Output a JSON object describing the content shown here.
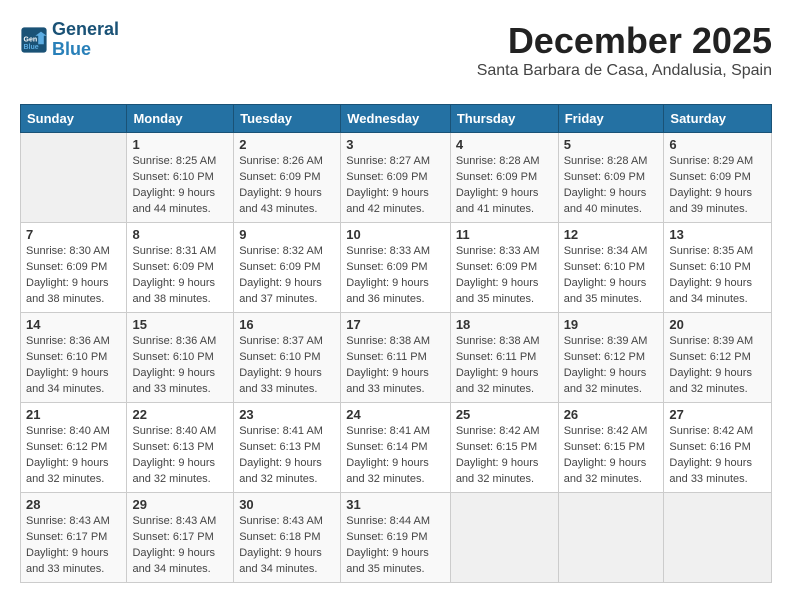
{
  "logo": {
    "line1": "General",
    "line2": "Blue"
  },
  "title": "December 2025",
  "location": "Santa Barbara de Casa, Andalusia, Spain",
  "days_of_week": [
    "Sunday",
    "Monday",
    "Tuesday",
    "Wednesday",
    "Thursday",
    "Friday",
    "Saturday"
  ],
  "weeks": [
    [
      {
        "day": "",
        "sunrise": "",
        "sunset": "",
        "daylight": ""
      },
      {
        "day": "1",
        "sunrise": "Sunrise: 8:25 AM",
        "sunset": "Sunset: 6:10 PM",
        "daylight": "Daylight: 9 hours and 44 minutes."
      },
      {
        "day": "2",
        "sunrise": "Sunrise: 8:26 AM",
        "sunset": "Sunset: 6:09 PM",
        "daylight": "Daylight: 9 hours and 43 minutes."
      },
      {
        "day": "3",
        "sunrise": "Sunrise: 8:27 AM",
        "sunset": "Sunset: 6:09 PM",
        "daylight": "Daylight: 9 hours and 42 minutes."
      },
      {
        "day": "4",
        "sunrise": "Sunrise: 8:28 AM",
        "sunset": "Sunset: 6:09 PM",
        "daylight": "Daylight: 9 hours and 41 minutes."
      },
      {
        "day": "5",
        "sunrise": "Sunrise: 8:28 AM",
        "sunset": "Sunset: 6:09 PM",
        "daylight": "Daylight: 9 hours and 40 minutes."
      },
      {
        "day": "6",
        "sunrise": "Sunrise: 8:29 AM",
        "sunset": "Sunset: 6:09 PM",
        "daylight": "Daylight: 9 hours and 39 minutes."
      }
    ],
    [
      {
        "day": "7",
        "sunrise": "Sunrise: 8:30 AM",
        "sunset": "Sunset: 6:09 PM",
        "daylight": "Daylight: 9 hours and 38 minutes."
      },
      {
        "day": "8",
        "sunrise": "Sunrise: 8:31 AM",
        "sunset": "Sunset: 6:09 PM",
        "daylight": "Daylight: 9 hours and 38 minutes."
      },
      {
        "day": "9",
        "sunrise": "Sunrise: 8:32 AM",
        "sunset": "Sunset: 6:09 PM",
        "daylight": "Daylight: 9 hours and 37 minutes."
      },
      {
        "day": "10",
        "sunrise": "Sunrise: 8:33 AM",
        "sunset": "Sunset: 6:09 PM",
        "daylight": "Daylight: 9 hours and 36 minutes."
      },
      {
        "day": "11",
        "sunrise": "Sunrise: 8:33 AM",
        "sunset": "Sunset: 6:09 PM",
        "daylight": "Daylight: 9 hours and 35 minutes."
      },
      {
        "day": "12",
        "sunrise": "Sunrise: 8:34 AM",
        "sunset": "Sunset: 6:10 PM",
        "daylight": "Daylight: 9 hours and 35 minutes."
      },
      {
        "day": "13",
        "sunrise": "Sunrise: 8:35 AM",
        "sunset": "Sunset: 6:10 PM",
        "daylight": "Daylight: 9 hours and 34 minutes."
      }
    ],
    [
      {
        "day": "14",
        "sunrise": "Sunrise: 8:36 AM",
        "sunset": "Sunset: 6:10 PM",
        "daylight": "Daylight: 9 hours and 34 minutes."
      },
      {
        "day": "15",
        "sunrise": "Sunrise: 8:36 AM",
        "sunset": "Sunset: 6:10 PM",
        "daylight": "Daylight: 9 hours and 33 minutes."
      },
      {
        "day": "16",
        "sunrise": "Sunrise: 8:37 AM",
        "sunset": "Sunset: 6:10 PM",
        "daylight": "Daylight: 9 hours and 33 minutes."
      },
      {
        "day": "17",
        "sunrise": "Sunrise: 8:38 AM",
        "sunset": "Sunset: 6:11 PM",
        "daylight": "Daylight: 9 hours and 33 minutes."
      },
      {
        "day": "18",
        "sunrise": "Sunrise: 8:38 AM",
        "sunset": "Sunset: 6:11 PM",
        "daylight": "Daylight: 9 hours and 32 minutes."
      },
      {
        "day": "19",
        "sunrise": "Sunrise: 8:39 AM",
        "sunset": "Sunset: 6:12 PM",
        "daylight": "Daylight: 9 hours and 32 minutes."
      },
      {
        "day": "20",
        "sunrise": "Sunrise: 8:39 AM",
        "sunset": "Sunset: 6:12 PM",
        "daylight": "Daylight: 9 hours and 32 minutes."
      }
    ],
    [
      {
        "day": "21",
        "sunrise": "Sunrise: 8:40 AM",
        "sunset": "Sunset: 6:12 PM",
        "daylight": "Daylight: 9 hours and 32 minutes."
      },
      {
        "day": "22",
        "sunrise": "Sunrise: 8:40 AM",
        "sunset": "Sunset: 6:13 PM",
        "daylight": "Daylight: 9 hours and 32 minutes."
      },
      {
        "day": "23",
        "sunrise": "Sunrise: 8:41 AM",
        "sunset": "Sunset: 6:13 PM",
        "daylight": "Daylight: 9 hours and 32 minutes."
      },
      {
        "day": "24",
        "sunrise": "Sunrise: 8:41 AM",
        "sunset": "Sunset: 6:14 PM",
        "daylight": "Daylight: 9 hours and 32 minutes."
      },
      {
        "day": "25",
        "sunrise": "Sunrise: 8:42 AM",
        "sunset": "Sunset: 6:15 PM",
        "daylight": "Daylight: 9 hours and 32 minutes."
      },
      {
        "day": "26",
        "sunrise": "Sunrise: 8:42 AM",
        "sunset": "Sunset: 6:15 PM",
        "daylight": "Daylight: 9 hours and 32 minutes."
      },
      {
        "day": "27",
        "sunrise": "Sunrise: 8:42 AM",
        "sunset": "Sunset: 6:16 PM",
        "daylight": "Daylight: 9 hours and 33 minutes."
      }
    ],
    [
      {
        "day": "28",
        "sunrise": "Sunrise: 8:43 AM",
        "sunset": "Sunset: 6:17 PM",
        "daylight": "Daylight: 9 hours and 33 minutes."
      },
      {
        "day": "29",
        "sunrise": "Sunrise: 8:43 AM",
        "sunset": "Sunset: 6:17 PM",
        "daylight": "Daylight: 9 hours and 34 minutes."
      },
      {
        "day": "30",
        "sunrise": "Sunrise: 8:43 AM",
        "sunset": "Sunset: 6:18 PM",
        "daylight": "Daylight: 9 hours and 34 minutes."
      },
      {
        "day": "31",
        "sunrise": "Sunrise: 8:44 AM",
        "sunset": "Sunset: 6:19 PM",
        "daylight": "Daylight: 9 hours and 35 minutes."
      },
      {
        "day": "",
        "sunrise": "",
        "sunset": "",
        "daylight": ""
      },
      {
        "day": "",
        "sunrise": "",
        "sunset": "",
        "daylight": ""
      },
      {
        "day": "",
        "sunrise": "",
        "sunset": "",
        "daylight": ""
      }
    ]
  ]
}
